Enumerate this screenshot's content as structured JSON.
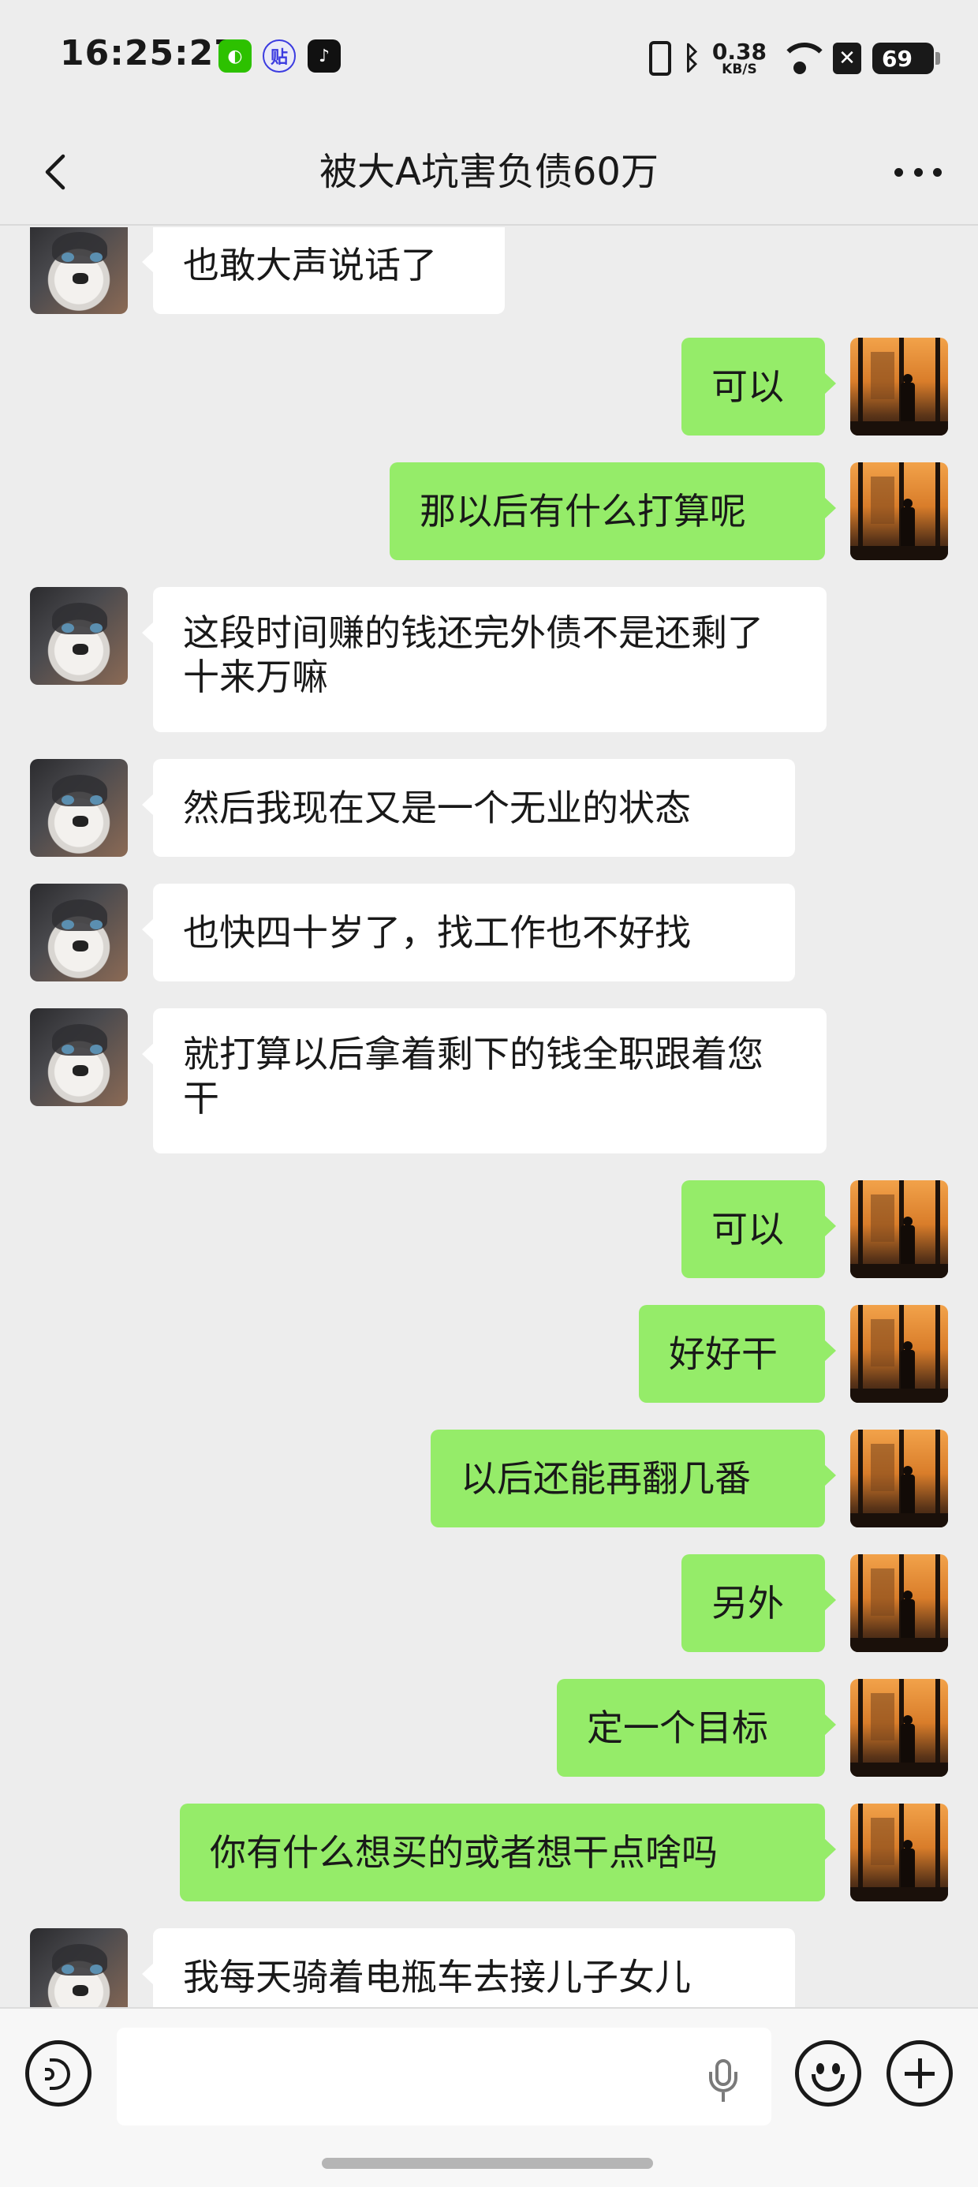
{
  "status_bar": {
    "time": "16:25:27",
    "apps": [
      "wechat",
      "tieba",
      "tiktok"
    ],
    "tieba_glyph": "贴",
    "tiktok_glyph": "♪",
    "wechat_glyph": "◐",
    "bluetooth": "ᛒ",
    "net_speed_value": "0.38",
    "net_speed_unit": "KB/S",
    "x_glyph": "✕",
    "battery": "69"
  },
  "nav": {
    "title": "被大A坑害负债60万",
    "back_icon": "chevron-left-icon",
    "more_icon": "more-dots-icon"
  },
  "messages": [
    {
      "side": "left",
      "text": "也敢大声说话了"
    },
    {
      "side": "right",
      "text": "可以"
    },
    {
      "side": "right",
      "text": "那以后有什么打算呢"
    },
    {
      "side": "left",
      "text": "这段时间赚的钱还完外债不是还剩了十来万嘛"
    },
    {
      "side": "left",
      "text": "然后我现在又是一个无业的状态"
    },
    {
      "side": "left",
      "text": "也快四十岁了，找工作也不好找"
    },
    {
      "side": "left",
      "text": "就打算以后拿着剩下的钱全职跟着您干"
    },
    {
      "side": "right",
      "text": "可以"
    },
    {
      "side": "right",
      "text": "好好干"
    },
    {
      "side": "right",
      "text": "以后还能再翻几番"
    },
    {
      "side": "right",
      "text": "另外"
    },
    {
      "side": "right",
      "text": "定一个目标"
    },
    {
      "side": "right",
      "text": "你有什么想买的或者想干点啥吗"
    },
    {
      "side": "left",
      "text": "我每天骑着电瓶车去接儿子女儿"
    }
  ],
  "colors": {
    "background": "#ededed",
    "sent_bubble": "#95ec69",
    "received_bubble": "#ffffff"
  },
  "input": {
    "value": "",
    "placeholder": ""
  }
}
